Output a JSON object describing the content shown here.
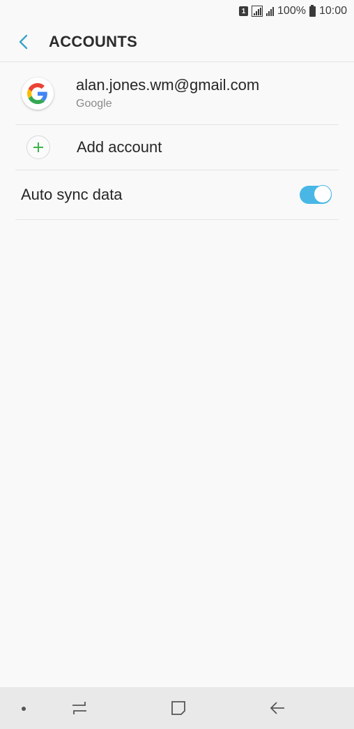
{
  "status_bar": {
    "sim_slot": "1",
    "battery": "100%",
    "time": "10:00"
  },
  "header": {
    "title": "ACCOUNTS",
    "back_icon": "chevron-left-icon"
  },
  "accounts": [
    {
      "email": "alan.jones.wm@gmail.com",
      "provider": "Google",
      "icon": "google-icon"
    }
  ],
  "add_account": {
    "label": "Add account",
    "icon": "plus-icon"
  },
  "auto_sync": {
    "label": "Auto sync data",
    "enabled": true
  },
  "colors": {
    "accent": "#48b7e5",
    "add_green": "#3cb34a"
  },
  "nav_bar": {
    "buttons": [
      "recents-icon",
      "home-icon",
      "back-icon"
    ]
  }
}
